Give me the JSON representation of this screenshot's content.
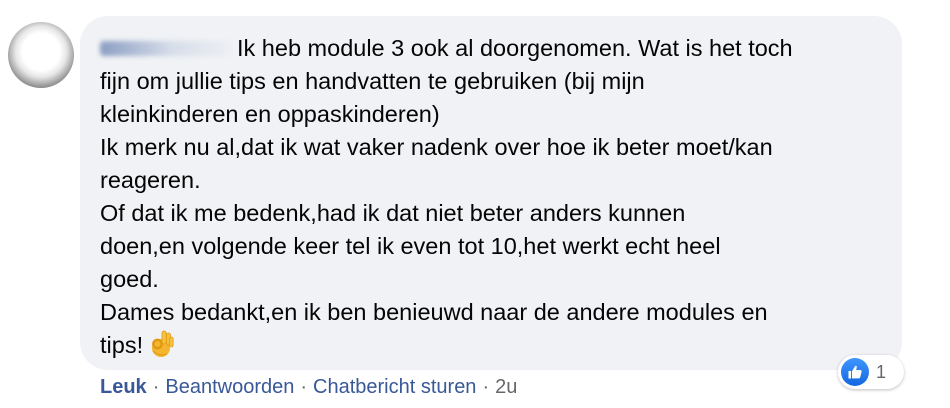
{
  "comment": {
    "author_name": "",
    "lines": [
      "Ik heb module 3 ook al doorgenomen. Wat is het toch",
      "fijn om jullie tips en handvatten te gebruiken (bij mijn",
      "kleinkinderen en oppaskinderen)",
      "Ik merk nu al,dat ik wat vaker nadenk over hoe ik beter moet/kan",
      "reageren.",
      "Of dat ik me bedenk,had ik dat niet beter anders kunnen",
      "doen,en volgende keer tel ik even tot 10,het werkt echt heel",
      "goed.",
      "Dames bedankt,en ik ben benieuwd naar de andere modules en",
      "tips!"
    ],
    "emoji": "ok-hand-emoji"
  },
  "reactions": {
    "icon": "thumbs-up-icon",
    "count": "1",
    "color": "#1877f2"
  },
  "actions": {
    "like": "Leuk",
    "reply": "Beantwoorden",
    "message": "Chatbericht sturen",
    "timestamp": "2u",
    "separator": "·"
  },
  "colors": {
    "bubble": "#f0f2f5",
    "link": "#385898",
    "meta": "#65676b",
    "text": "#050505"
  }
}
